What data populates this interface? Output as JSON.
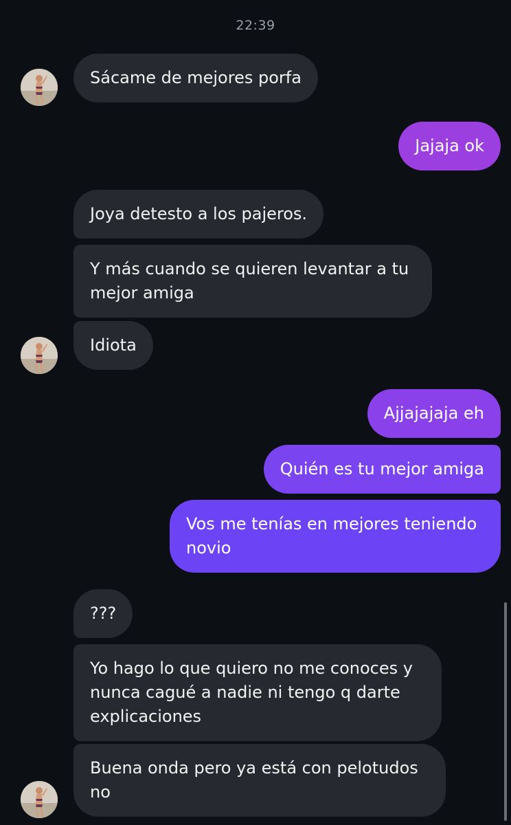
{
  "timestamp": "22:39",
  "messages": [
    {
      "text": "Sácame de mejores porfa"
    },
    {
      "text": "Jajaja ok"
    },
    {
      "text": "Joya detesto a los pajeros."
    },
    {
      "line1": "Y más cuando se quieren levantar a tu",
      "line2": "mejor amiga"
    },
    {
      "text": "Idiota"
    },
    {
      "text": "Ajjajajaja eh"
    },
    {
      "text": "Quién es tu mejor amiga"
    },
    {
      "line1": "Vos me tenías en mejores teniendo",
      "line2": "novio"
    },
    {
      "text": "???"
    },
    {
      "line1": "Yo hago lo que quiero no me conoces y",
      "line2": "nunca cagué a nadie ni tengo q darte",
      "line3": "explicaciones"
    },
    {
      "line1": "Buena onda pero ya está con pelotudos",
      "line2": "no"
    }
  ],
  "colors": {
    "background": "#0c0f14",
    "incoming_bubble": "#262a30",
    "outgoing_purple": "#9b3fe0",
    "outgoing_violet": "#6c43f5"
  },
  "icons": {
    "avatar": "contact-avatar-photo"
  }
}
